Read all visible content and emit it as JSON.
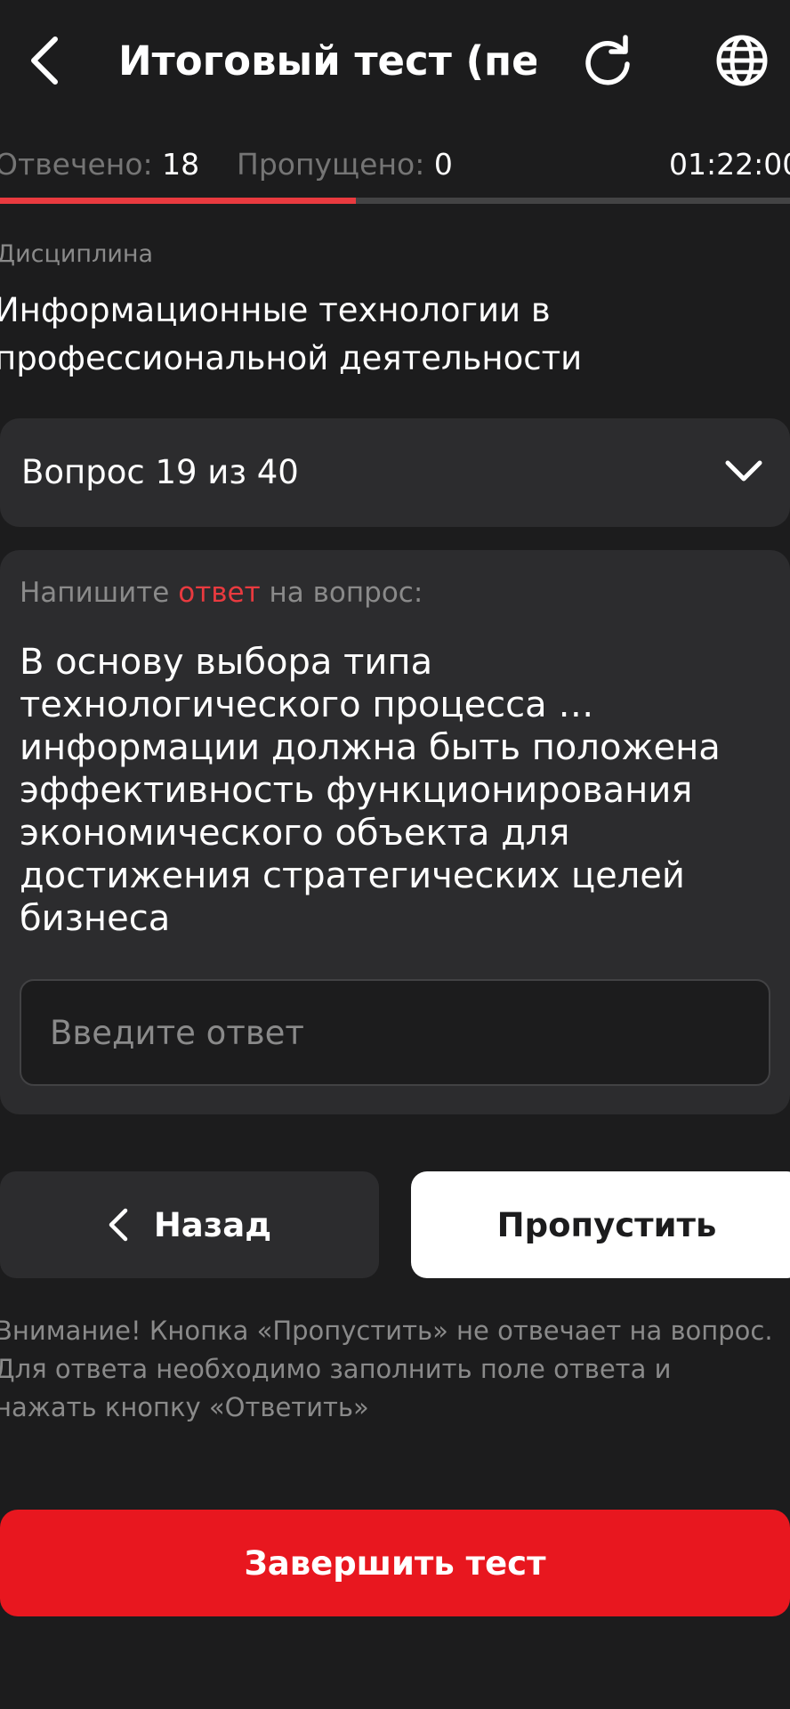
{
  "header": {
    "title": "Итоговый тест (пе…",
    "back_icon": "chevron-left-icon",
    "reload_icon": "reload-icon",
    "language_icon": "globe-icon"
  },
  "stats": {
    "answered_label": "Отвечено:",
    "answered_value": "18",
    "skipped_label": "Пропущено:",
    "skipped_value": "0",
    "timer": "01:22:00"
  },
  "progress": {
    "answered": 18,
    "total": 40
  },
  "discipline": {
    "label": "Дисциплина",
    "value": "Информационные технологии в профессиональной деятельности"
  },
  "question_selector": {
    "label": "Вопрос 19 из 40",
    "icon": "chevron-down-icon"
  },
  "question": {
    "instruction_before": "Напишите ",
    "instruction_accent": "ответ",
    "instruction_after": " на вопрос:",
    "text": "В основу выбора типа технологического процесса … информации должна быть положена эффективность функционирования экономического объекта для достижения стратегических целей бизнеса",
    "answer_placeholder": "Введите ответ",
    "answer_value": ""
  },
  "buttons": {
    "back_label": "Назад",
    "skip_label": "Пропустить",
    "finish_label": "Завершить тест"
  },
  "warning": "Внимание! Кнопка «Пропустить» не отвечает на вопрос. Для ответа необходимо заполнить поле ответа и нажать кнопку «Ответить»",
  "colors": {
    "background": "#1c1c1d",
    "card": "#2c2c2e",
    "accent_red": "#e93a3f",
    "finish_red": "#e8171f",
    "muted_text": "#8a8a8a"
  }
}
